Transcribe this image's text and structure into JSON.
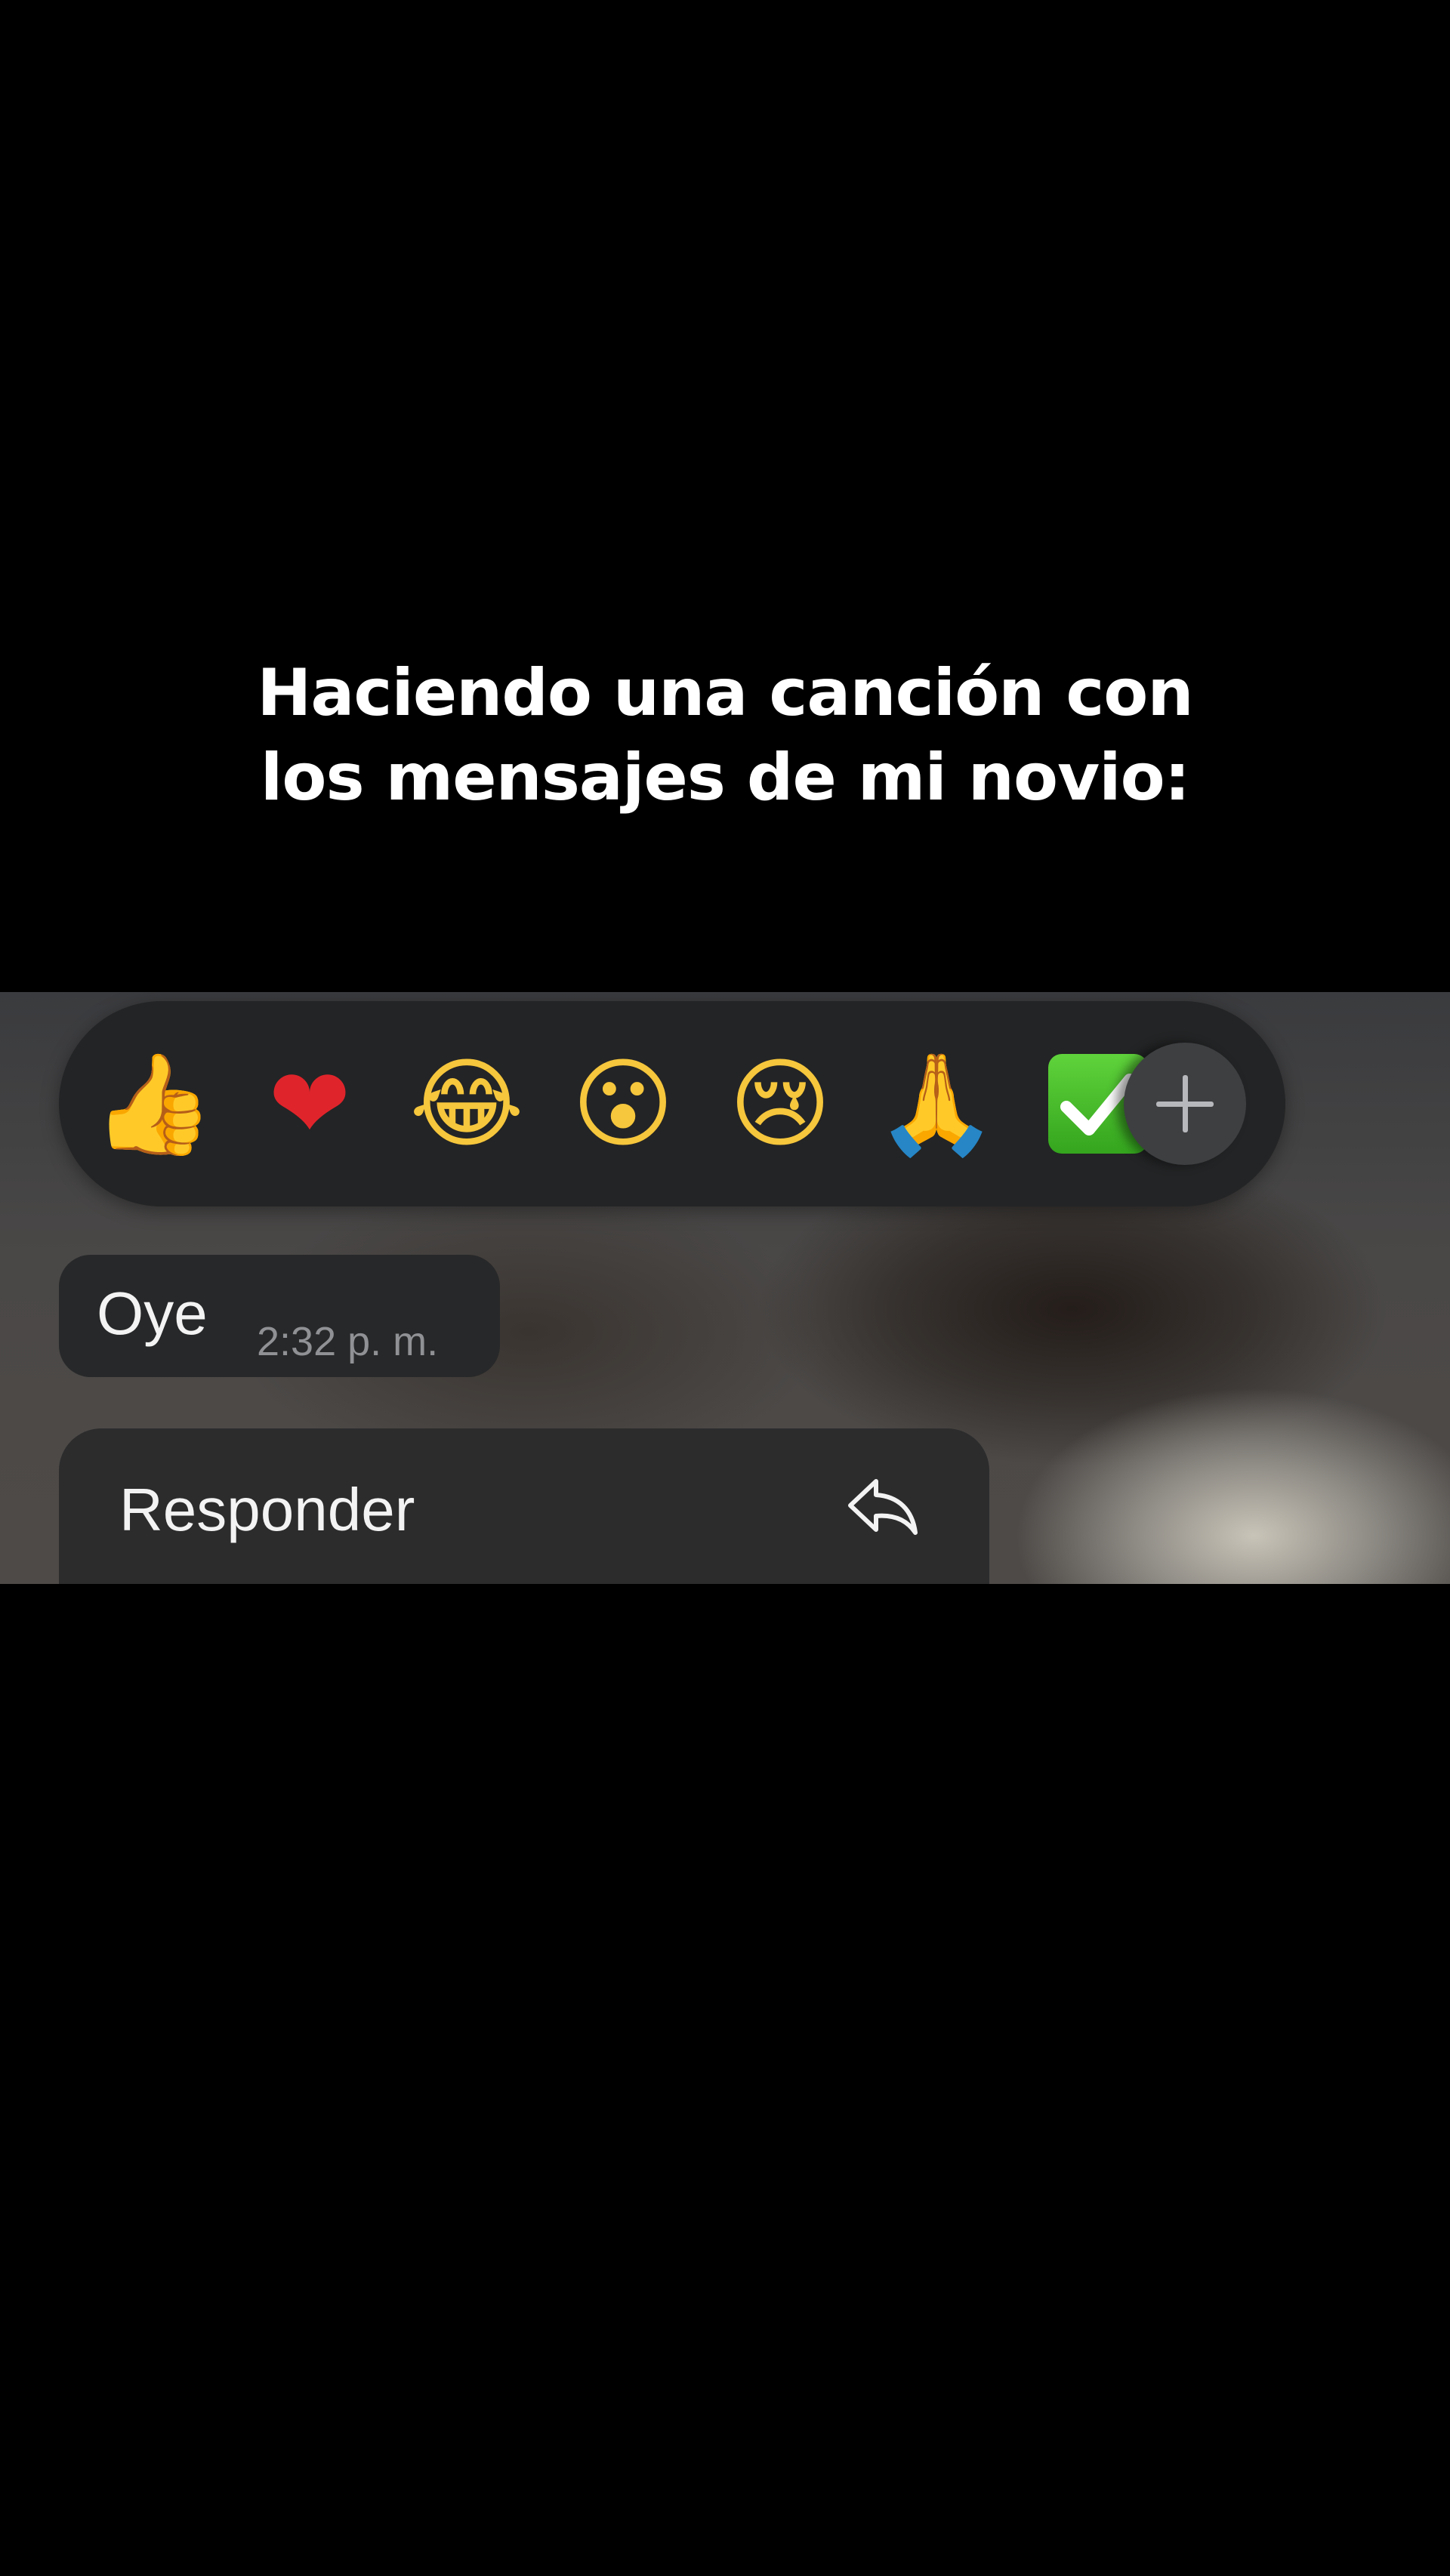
{
  "caption": {
    "line1": "Haciendo una canción con",
    "line2": "los mensajes de mi novio:"
  },
  "reactions": {
    "items": [
      {
        "glyph": "👍",
        "icon": "thumbs-up-icon"
      },
      {
        "glyph": "❤",
        "icon": "red-heart-icon"
      },
      {
        "glyph": "😂",
        "icon": "tears-of-joy-icon"
      },
      {
        "glyph": "😮",
        "icon": "surprised-face-icon"
      },
      {
        "glyph": "😢",
        "icon": "crying-face-icon"
      },
      {
        "glyph": "🙏",
        "icon": "folded-hands-icon"
      }
    ],
    "more_icon": "green-check-icon",
    "add_icon": "plus-icon"
  },
  "message": {
    "text": "Oye",
    "time": "2:32 p. m."
  },
  "menu": {
    "reply_label": "Responder",
    "reply_icon": "reply-arrow-icon"
  },
  "colors": {
    "background": "#000000",
    "reaction_bar": "#232425",
    "bubble": "#272829",
    "menu": "#2c2c2d",
    "timestamp": "#8f9194"
  }
}
